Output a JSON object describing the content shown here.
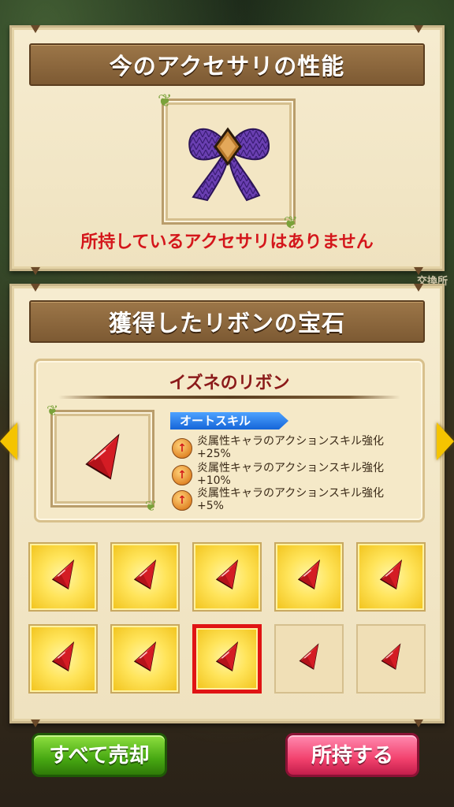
{
  "current_accessory": {
    "title": "今のアクセサリの性能",
    "none_message": "所持しているアクセサリはありません",
    "icon": "purple-ribbon-icon"
  },
  "shop_sign": "交換所",
  "obtained": {
    "title": "獲得したリボンの宝石",
    "ribbon_name": "イズネのリボン",
    "auto_skill_label": "オートスキル",
    "skills": [
      {
        "badge": "↑",
        "text": "炎属性キャラのアクションスキル強化+25%"
      },
      {
        "badge": "↑",
        "text": "炎属性キャラのアクションスキル強化+10%"
      },
      {
        "badge": "↑",
        "text": "炎属性キャラのアクションスキル強化+5%"
      }
    ],
    "gem_icon": "red-gem-icon"
  },
  "gem_slots": [
    {
      "state": "owned"
    },
    {
      "state": "owned"
    },
    {
      "state": "owned"
    },
    {
      "state": "owned"
    },
    {
      "state": "owned"
    },
    {
      "state": "owned"
    },
    {
      "state": "owned"
    },
    {
      "state": "owned-selected"
    },
    {
      "state": "empty"
    },
    {
      "state": "empty"
    }
  ],
  "buttons": {
    "sell_all": "すべて売却",
    "equip": "所持する"
  },
  "colors": {
    "warning_text": "#d4161b",
    "header_bar": "#8a6640",
    "selected_border": "#e01414",
    "sell_button": "#47a812",
    "equip_button": "#f2416d",
    "nav_arrow": "#f5c400"
  }
}
